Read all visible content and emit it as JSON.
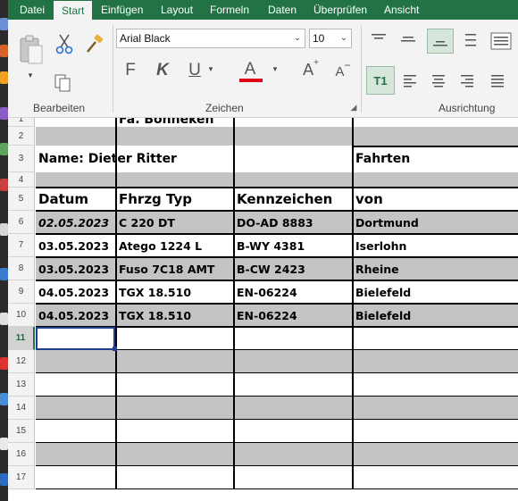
{
  "menu": {
    "tabs": [
      "Datei",
      "Start",
      "Einfügen",
      "Layout",
      "Formeln",
      "Daten",
      "Überprüfen",
      "Ansicht"
    ],
    "active": "Start"
  },
  "ribbon": {
    "font_name": "Arial Black",
    "font_size": "10",
    "group_edit": "Bearbeiten",
    "group_font": "Zeichen",
    "group_align": "Ausrichtung",
    "bold_glyph": "F",
    "italic_glyph": "K",
    "underline_glyph": "U",
    "fontcolor_glyph": "A",
    "grow_glyph": "A",
    "shrink_glyph": "A",
    "wrap_glyph": "T1",
    "accent_color": "#217346",
    "font_color_bar": "#e0001a"
  },
  "sheet": {
    "row_numbers": [
      "1",
      "2",
      "3",
      "4",
      "5",
      "6",
      "7",
      "8",
      "9",
      "10",
      "11",
      "12",
      "13",
      "14",
      "15",
      "16",
      "17"
    ],
    "title_top": "Fa. Bonneken",
    "name_label": "Name: Dieter Ritter",
    "fahrten_label": "Fahrten",
    "headers": [
      "Datum",
      "Fhrzg Typ",
      "Kennzeichen",
      "von"
    ],
    "records": [
      [
        "02.05.2023",
        "C 220 DT",
        "DO-AD 8883",
        "Dortmund"
      ],
      [
        "03.05.2023",
        "Atego 1224 L",
        "B-WY 4381",
        "Iserlohn"
      ],
      [
        "03.05.2023",
        "Fuso 7C18 AMT",
        "B-CW 2423",
        "Rheine"
      ],
      [
        "04.05.2023",
        "TGX 18.510",
        "EN-06224",
        "Bielefeld"
      ],
      [
        "04.05.2023",
        "TGX 18.510",
        "EN-06224",
        "Bielefeld"
      ]
    ],
    "selected_row": "11"
  }
}
